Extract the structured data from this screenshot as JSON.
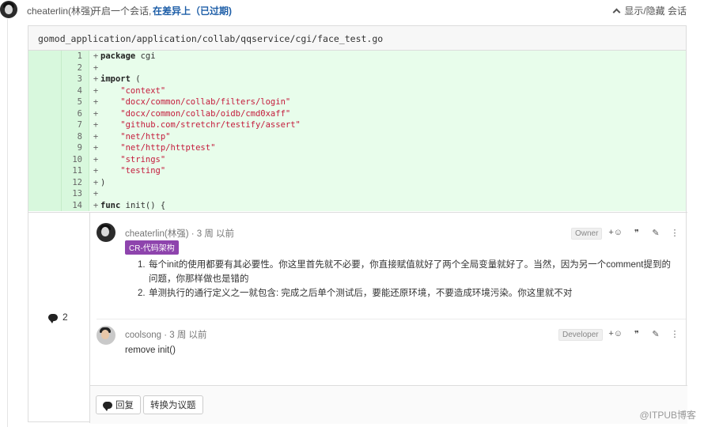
{
  "header": {
    "author": "cheaterlin(林强)",
    "action": "开启一个会话,",
    "link": "在差异上（已过期)",
    "toggle_label": "显示/隐藏 会话"
  },
  "file": {
    "path": "gomod_application/application/collab/qqservice/cgi/face_test.go",
    "lines": [
      {
        "n": "1",
        "text": "package cgi"
      },
      {
        "n": "2",
        "text": ""
      },
      {
        "n": "3",
        "text": "import ("
      },
      {
        "n": "4",
        "text": "    \"context\""
      },
      {
        "n": "5",
        "text": "    \"docx/common/collab/filters/login\""
      },
      {
        "n": "6",
        "text": "    \"docx/common/collab/oidb/cmd0xaff\""
      },
      {
        "n": "7",
        "text": "    \"github.com/stretchr/testify/assert\""
      },
      {
        "n": "8",
        "text": "    \"net/http\""
      },
      {
        "n": "9",
        "text": "    \"net/http/httptest\""
      },
      {
        "n": "10",
        "text": "    \"strings\""
      },
      {
        "n": "11",
        "text": "    \"testing\""
      },
      {
        "n": "12",
        "text": ")"
      },
      {
        "n": "13",
        "text": ""
      },
      {
        "n": "14",
        "text": "func init() {"
      }
    ]
  },
  "discussion": {
    "count": "2",
    "notes": [
      {
        "author": "cheaterlin(林强)",
        "time": "· 3 周 以前",
        "role": "Owner",
        "label": "CR-代码架构",
        "items": [
          {
            "num": "1.",
            "text": "每个init的使用都要有其必要性。你这里首先就不必要，你直接赋值就好了两个全局变量就好了。当然，因为另一个comment提到的问题，你那样做也是错的"
          },
          {
            "num": "2.",
            "text": "单测执行的通行定义之一就包含: 完成之后单个测试后，要能还原环境，不要造成环境污染。你这里就不对"
          }
        ]
      },
      {
        "author": "coolsong",
        "time": "· 3 周 以前",
        "role": "Developer",
        "body": "remove init()"
      }
    ],
    "actions": {
      "emoji": "+☺",
      "quote": "❞",
      "edit": "✎",
      "more": "⋮"
    },
    "reply_label": "回复",
    "convert_label": "转换为议题"
  },
  "watermark": "@ITPUB博客"
}
